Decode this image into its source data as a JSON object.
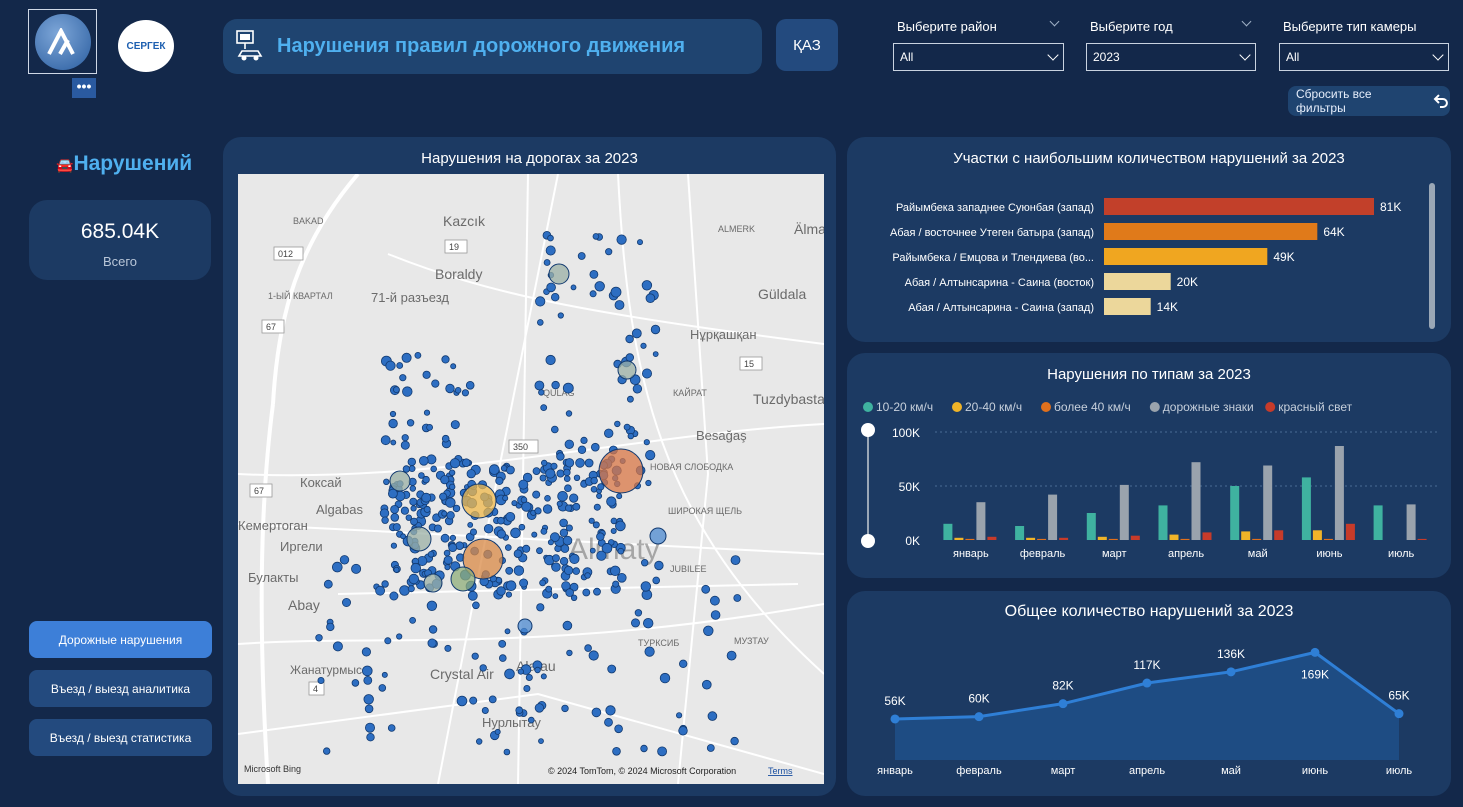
{
  "header": {
    "title": "Нарушения правил дорожного движения",
    "logo2_text": "СЕРГЕК",
    "lang_button": "ҚАЗ",
    "more_button": "•••"
  },
  "filters": {
    "district": {
      "label": "Выберите район",
      "value": "All"
    },
    "year": {
      "label": "Выберите год",
      "value": "2023"
    },
    "camera": {
      "label": "Выберите тип камеры",
      "value": "All"
    },
    "reset_label": "Сбросить все фильтры"
  },
  "kpi": {
    "title": "Нарушений",
    "value": "685.04K",
    "label": "Всего"
  },
  "nav": [
    {
      "label": "Дорожные нарушения"
    },
    {
      "label": "Въезд / выезд аналитика"
    },
    {
      "label": "Въезд / выезд статистика"
    }
  ],
  "map": {
    "title": "Нарушения на дорогах за 2023",
    "bing": "Microsoft Bing",
    "copyright": "© 2024 TomTom, © 2024 Microsoft Corporation",
    "terms": "Terms",
    "place_labels": [
      {
        "text": "Kazcık",
        "size": 14
      },
      {
        "text": "Boraldy",
        "size": 14
      },
      {
        "text": "71-й разъезд",
        "size": 13
      },
      {
        "text": "Älmaly",
        "size": 14
      },
      {
        "text": "Güldala",
        "size": 14
      },
      {
        "text": "Нұрқашқан",
        "size": 13
      },
      {
        "text": "Tuzdybastau",
        "size": 14
      },
      {
        "text": "Besağaş",
        "size": 13
      },
      {
        "text": "Коксай",
        "size": 13
      },
      {
        "text": "Algabas",
        "size": 13
      },
      {
        "text": "Кемертоган",
        "size": 13
      },
      {
        "text": "Иргели",
        "size": 13
      },
      {
        "text": "Булакты",
        "size": 13
      },
      {
        "text": "Abay",
        "size": 14
      },
      {
        "text": "Жанатурмыс",
        "size": 12
      },
      {
        "text": "Crystal Air",
        "size": 14
      },
      {
        "text": "Alatau",
        "size": 14
      },
      {
        "text": "Нурлытау",
        "size": 13
      },
      {
        "text": "1-ЫЙ КВАРТАЛ",
        "size": 9
      },
      {
        "text": "КАЙРАТ",
        "size": 9
      },
      {
        "text": "ШИРОКАЯ ЩЕЛЬ",
        "size": 9
      },
      {
        "text": "JUBILEE",
        "size": 9
      },
      {
        "text": "МУЗТАУ",
        "size": 9
      },
      {
        "text": "ТУРКСИБ",
        "size": 9
      },
      {
        "text": "BAKAD",
        "size": 9
      },
      {
        "text": "ALMERK",
        "size": 9
      },
      {
        "text": "QULAG",
        "size": 9
      },
      {
        "text": "НОВАЯ СЛОБОДКА",
        "size": 9
      },
      {
        "text": "Almaty",
        "size": 30
      }
    ],
    "road_numbers": [
      "19",
      "012",
      "67",
      "15",
      "350",
      "67",
      "4"
    ]
  },
  "top_sections": {
    "title": "Участки с наибольшим количеством нарушений за 2023",
    "bars": [
      {
        "label": "Райымбека западнее Суюнбая (запад)",
        "value": 81,
        "display": "81K",
        "color": "#c2402a"
      },
      {
        "label": "Абая / восточнее Утеген батыра (запад)",
        "value": 64,
        "display": "64K",
        "color": "#e07a1a"
      },
      {
        "label": "Райымбека / Емцова и Тлендиева (во...",
        "value": 49,
        "display": "49K",
        "color": "#f0a620"
      },
      {
        "label": "Абая / Алтынсарина - Саина (восток)",
        "value": 20,
        "display": "20K",
        "color": "#ecd79b"
      },
      {
        "label": "Абая / Алтынсарина - Саина (запад)",
        "value": 14,
        "display": "14K",
        "color": "#ecd79b"
      }
    ]
  },
  "chart_data": [
    {
      "type": "bar",
      "title": "Нарушения по типам за 2023",
      "categories": [
        "январь",
        "февраль",
        "март",
        "апрель",
        "май",
        "июнь",
        "июль"
      ],
      "ylim": [
        0,
        100000
      ],
      "yticks": [
        "100K",
        "50K",
        "0K"
      ],
      "legend_position": "top-left",
      "series": [
        {
          "name": "10-20 км/ч",
          "color": "#3fb2a0",
          "values": [
            15000,
            13000,
            25000,
            32000,
            50000,
            58000,
            32000
          ]
        },
        {
          "name": "20-40 км/ч",
          "color": "#f0b428",
          "values": [
            2000,
            2000,
            3000,
            5000,
            8000,
            9000,
            0
          ]
        },
        {
          "name": "более 40 км/ч",
          "color": "#e0701c",
          "values": [
            1000,
            1000,
            1000,
            1000,
            1000,
            1000,
            0
          ]
        },
        {
          "name": "дорожные знаки",
          "color": "#9aa3ad",
          "values": [
            35000,
            42000,
            51000,
            72000,
            69000,
            87000,
            33000
          ]
        },
        {
          "name": "красный свет",
          "color": "#c73b2a",
          "values": [
            3000,
            2000,
            4000,
            7000,
            9000,
            15000,
            1000
          ]
        }
      ]
    },
    {
      "type": "area",
      "title": "Общее количество нарушений за 2023",
      "categories": [
        "январь",
        "февраль",
        "март",
        "апрель",
        "май",
        "июнь",
        "июль"
      ],
      "values": [
        56,
        60,
        82,
        117,
        136,
        169,
        65
      ],
      "labels": [
        "56K",
        "60K",
        "82K",
        "117K",
        "136K",
        "169K",
        "65K"
      ],
      "ylim": [
        0,
        190
      ],
      "color": "#2f7fd6"
    }
  ]
}
